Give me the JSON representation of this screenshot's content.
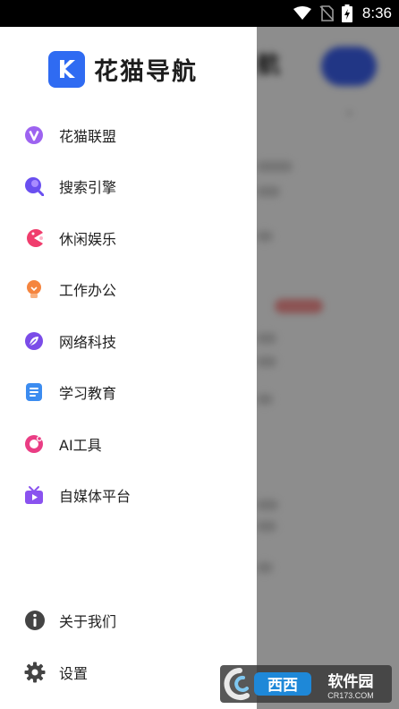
{
  "status_bar": {
    "time": "8:36"
  },
  "drawer": {
    "app_name": "花猫导航",
    "menu": [
      {
        "label": "花猫联盟",
        "icon": "v-badge-icon",
        "color": "#9d63f0"
      },
      {
        "label": "搜索引擎",
        "icon": "search-bubble-icon",
        "color": "#6a4ff0"
      },
      {
        "label": "休闲娱乐",
        "icon": "pacman-game-icon",
        "color": "#f03d6d"
      },
      {
        "label": "工作办公",
        "icon": "lightbulb-icon",
        "color": "#f5853f"
      },
      {
        "label": "网络科技",
        "icon": "leaf-compass-icon",
        "color": "#7b4ce8"
      },
      {
        "label": "学习教育",
        "icon": "document-icon",
        "color": "#3c8cf0"
      },
      {
        "label": "AI工具",
        "icon": "ring-icon",
        "color": "#ea3d84"
      },
      {
        "label": "自媒体平台",
        "icon": "tv-icon",
        "color": "#8a52ef"
      }
    ],
    "about": {
      "label": "关于我们",
      "icon": "info-icon"
    },
    "settings": {
      "label": "设置",
      "icon": "gear-icon"
    }
  },
  "background": {
    "title": "航"
  },
  "watermark": {
    "brand": "西西软件园",
    "domain": "CR173.COM"
  }
}
